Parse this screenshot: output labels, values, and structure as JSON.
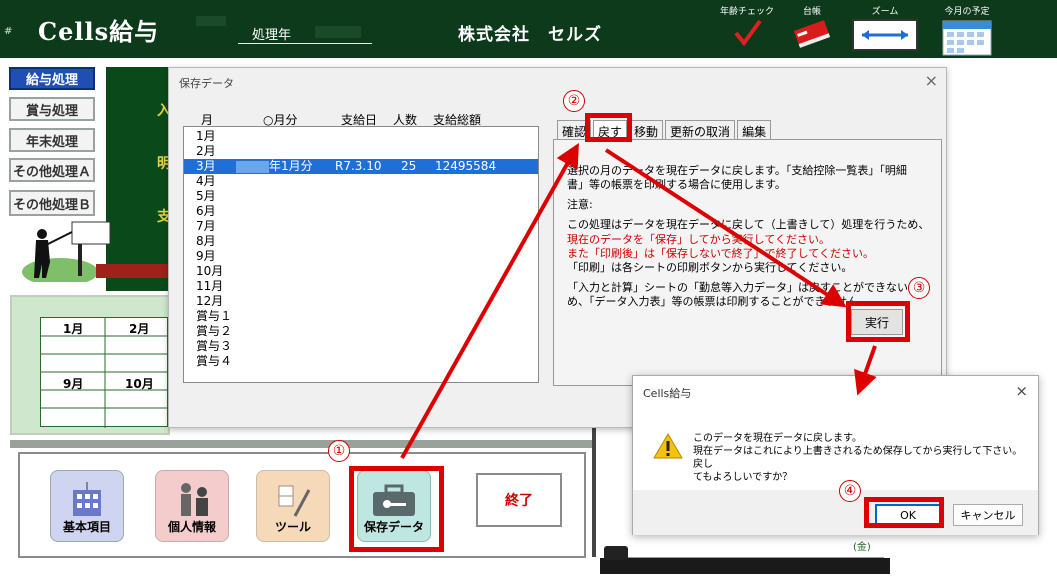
{
  "header": {
    "brand": "Cells給与",
    "hash": "#",
    "year_label": "処理年",
    "company": "株式会社　セルズ",
    "tools": [
      {
        "label": "年齢チェック",
        "icon": "checkmark-icon"
      },
      {
        "label": "台帳",
        "icon": "ledger-book-icon"
      },
      {
        "label": "ズーム",
        "icon": "zoom-icon"
      },
      {
        "label": "今月の予定",
        "icon": "calendar-icon"
      }
    ]
  },
  "nav": {
    "items": [
      {
        "label": "給与処理"
      },
      {
        "label": "賞与処理"
      },
      {
        "label": "年末処理"
      },
      {
        "label": "その他処理Ａ"
      },
      {
        "label": "その他処理Ｂ"
      }
    ]
  },
  "background": {
    "green_texts": [
      "入",
      "明",
      "支"
    ],
    "grid": {
      "row1": [
        "1月",
        "2月"
      ],
      "row2": [
        "9月",
        "10月"
      ]
    },
    "bottom_buttons": [
      {
        "label": "基本項目",
        "icon": "building-icon"
      },
      {
        "label": "個人情報",
        "icon": "people-icon"
      },
      {
        "label": "ツール",
        "icon": "tools-icon"
      },
      {
        "label": "保存データ",
        "icon": "briefcase-key-icon"
      }
    ],
    "exit_label": "終了",
    "yen_mark": "(金)"
  },
  "save_dialog": {
    "title": "保存データ",
    "close": "×",
    "columns": [
      "月",
      "○月分",
      "支給日",
      "人数",
      "支給総額"
    ],
    "rows": [
      {
        "m": "1月"
      },
      {
        "m": "2月"
      },
      {
        "m": "3月",
        "period": "年1月分",
        "date": "R7.3.10",
        "count": "25",
        "total": "12495584",
        "selected": true
      },
      {
        "m": "4月"
      },
      {
        "m": "5月"
      },
      {
        "m": "6月"
      },
      {
        "m": "7月"
      },
      {
        "m": "8月"
      },
      {
        "m": "9月"
      },
      {
        "m": "10月"
      },
      {
        "m": "11月"
      },
      {
        "m": "12月"
      },
      {
        "m": "賞与１"
      },
      {
        "m": "賞与２"
      },
      {
        "m": "賞与３"
      },
      {
        "m": "賞与４"
      }
    ],
    "tabs": [
      "確認",
      "戻す",
      "移動",
      "更新の取消",
      "編集"
    ],
    "active_tab": "戻す",
    "pane": {
      "line1": "選択の月のデータを現在データに戻します。「支給控除一覧表」「明細",
      "line2": "書」等の帳票を印刷する場合に使用します。",
      "note_label": "注意:",
      "note1": "この処理はデータを現在データに戻して（上書きして）処理を行うため、",
      "note2_red": "現在のデータを「保存」してから実行してください。",
      "note3_red": "また「印刷後」は「保存しないで終了」で終了してください。",
      "note4": "「印刷」は各シートの印刷ボタンから実行してください。",
      "note5": "「入力と計算」シートの「勤怠等入力データ」は戻すことができないた",
      "note6": "め、「データ入力表」等の帳票は印刷することができません。"
    },
    "exec_label": "実行"
  },
  "confirm_dialog": {
    "title": "Cells給与",
    "close": "×",
    "message1": "このデータを現在データに戻します。",
    "message2": "現在データはこれにより上書きされるため保存してから実行して下さい。戻し",
    "message3": "てもよろしいですか？",
    "ok_label": "OK",
    "cancel_label": "キャンセル",
    "icon": "warning-icon"
  },
  "annotations": {
    "step1": "①",
    "step2": "②",
    "step3": "③",
    "step4": "④",
    "color": "#dd0000"
  }
}
